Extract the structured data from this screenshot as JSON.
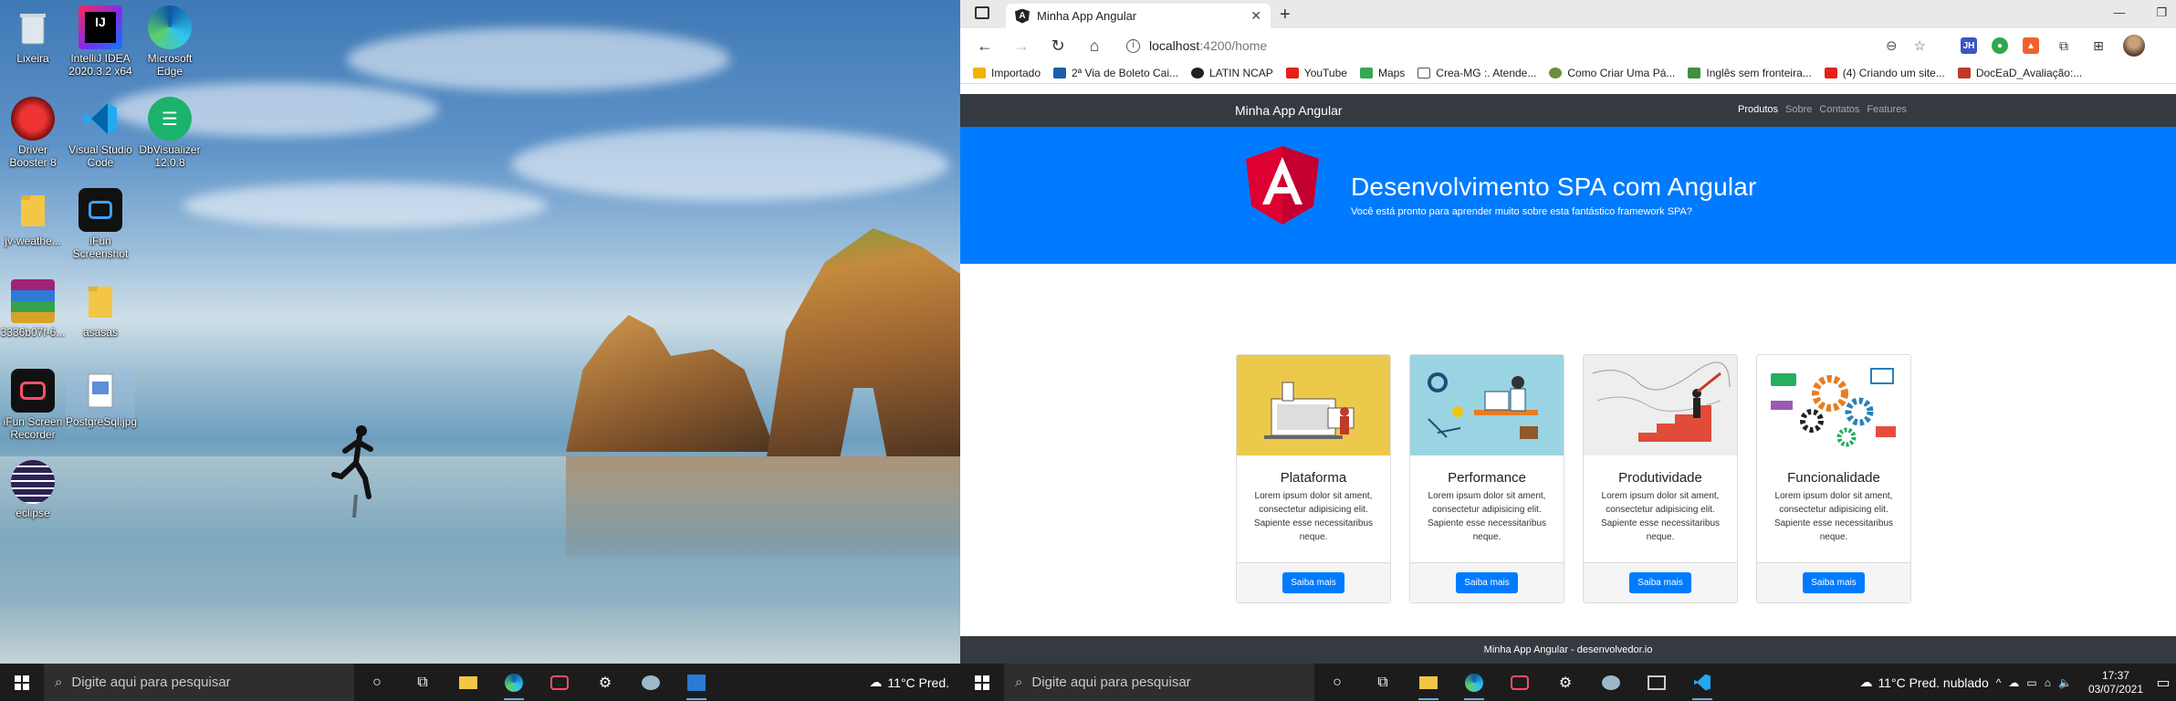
{
  "desktop": {
    "icons": [
      {
        "label": "Lixeira",
        "icon": "recycle-bin-icon"
      },
      {
        "label": "IntelliJ IDEA 2020.3.2 x64",
        "icon": "intellij-icon"
      },
      {
        "label": "Microsoft Edge",
        "icon": "edge-icon"
      },
      {
        "label": "Driver Booster 8",
        "icon": "driver-booster-icon"
      },
      {
        "label": "Visual Studio Code",
        "icon": "vscode-icon"
      },
      {
        "label": "DbVisualizer 12.0.8",
        "icon": "dbvisualizer-icon"
      },
      {
        "label": "jv-weathe...",
        "icon": "folder-icon"
      },
      {
        "label": "iFun Screenshot",
        "icon": "ifun-screenshot-icon"
      },
      {
        "label": "3336b07f-6...",
        "icon": "winrar-icon"
      },
      {
        "label": "asasas",
        "icon": "folder-icon"
      },
      {
        "label": "iFun Screen Recorder",
        "icon": "ifun-recorder-icon"
      },
      {
        "label": "PostgreSql.jpg",
        "icon": "image-file-icon"
      },
      {
        "label": "eclipse",
        "icon": "eclipse-icon"
      }
    ]
  },
  "browser": {
    "tab_title": "Minha App Angular",
    "url_host": "localhost",
    "url_path": ":4200/home",
    "bookmarks": [
      {
        "label": "Importado",
        "color": "#f0b400"
      },
      {
        "label": "2ª Via de Boleto Cai...",
        "color": "#1c5ea8"
      },
      {
        "label": "LATIN NCAP",
        "color": "#222222"
      },
      {
        "label": "YouTube",
        "color": "#e62117"
      },
      {
        "label": "Maps",
        "color": "#34a853"
      },
      {
        "label": "Crea-MG :. Atende...",
        "color": "#555555"
      },
      {
        "label": "Como Criar Uma Pá...",
        "color": "#6a8f3a"
      },
      {
        "label": "Inglês sem fronteira...",
        "color": "#3f8f3f"
      },
      {
        "label": "(4) Criando um site...",
        "color": "#e62117"
      },
      {
        "label": "DocEaD_Avaliação:...",
        "color": "#c0392b"
      }
    ]
  },
  "app": {
    "brand": "Minha App Angular",
    "nav": [
      "Produtos",
      "Sobre",
      "Contatos",
      "Features"
    ],
    "jumbo_title": "Desenvolvimento SPA com Angular",
    "jumbo_subtitle": "Você está pronto para aprender muito sobre esta fantástico framework SPA?",
    "cards": [
      {
        "title": "Plataforma",
        "text": "Lorem ipsum dolor sit ament, consectetur adipisicing elit. Sapiente esse necessitaribus neque.",
        "button": "Saiba mais"
      },
      {
        "title": "Performance",
        "text": "Lorem ipsum dolor sit ament, consectetur adipisicing elit. Sapiente esse necessitaribus neque.",
        "button": "Saiba mais"
      },
      {
        "title": "Produtividade",
        "text": "Lorem ipsum dolor sit ament, consectetur adipisicing elit. Sapiente esse necessitaribus neque.",
        "button": "Saiba mais"
      },
      {
        "title": "Funcionalidade",
        "text": "Lorem ipsum dolor sit ament, consectetur adipisicing elit. Sapiente esse necessitaribus neque.",
        "button": "Saiba mais"
      }
    ],
    "footer": "Minha App Angular - desenvolvedor.io"
  },
  "taskbar_left": {
    "search_placeholder": "Digite aqui para pesquisar",
    "weather": "11°C  Pred."
  },
  "taskbar_right": {
    "search_placeholder": "Digite aqui para pesquisar",
    "weather": "11°C  Pred. nublado",
    "time": "17:37",
    "date": "03/07/2021"
  },
  "colors": {
    "primary": "#007bff",
    "navbar": "#343a40",
    "angular_red": "#dd0031"
  }
}
